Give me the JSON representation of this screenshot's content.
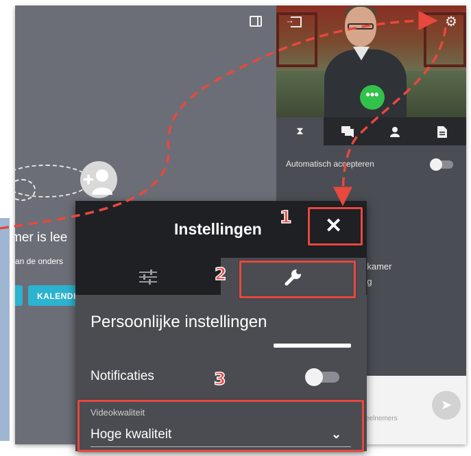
{
  "app": {
    "empty_state": {
      "title": "mer is lee",
      "subtitle": "van de onders",
      "button_kalender": "KALENDE"
    },
    "right_panel": {
      "auto_accept_label": "Automatisch accepteren",
      "waiting_line1": "chtkamer",
      "waiting_line2": "leeg",
      "chat_placeholder": "eelnemers",
      "tabs": [
        "hourglass-icon",
        "chat-icon",
        "person-icon",
        "document-icon"
      ]
    }
  },
  "dialog": {
    "title": "Instellingen",
    "tabs": [
      {
        "name": "sliders-icon",
        "active": false
      },
      {
        "name": "wrench-icon",
        "active": true
      }
    ],
    "section_title": "Persoonlijke instellingen",
    "notifications_label": "Notificaties",
    "notifications_on": false,
    "video_quality_label": "Videokwaliteit",
    "video_quality_value": "Hoge kwaliteit"
  },
  "annotations": {
    "step1": "1",
    "step2": "2",
    "step3": "3",
    "highlight_color": "#e8483e"
  },
  "colors": {
    "accent": "#2bb3cf",
    "call_green": "#32c14a",
    "panel_dark": "#1f2023"
  }
}
